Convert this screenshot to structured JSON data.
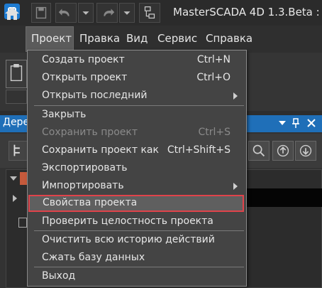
{
  "window": {
    "title": "MasterSCADA 4D 1.3.Beta : По"
  },
  "menubar": {
    "items": [
      "Проект",
      "Правка",
      "Вид",
      "Сервис",
      "Справка"
    ]
  },
  "panel": {
    "title": "Дере"
  },
  "dropdown": {
    "items": [
      {
        "label": "Создать проект",
        "shortcut": "Ctrl+N"
      },
      {
        "label": "Открыть проект",
        "shortcut": "Ctrl+O"
      },
      {
        "label": "Открыть последний",
        "shortcut": ""
      },
      {
        "label": "Закрыть",
        "shortcut": ""
      },
      {
        "label": "Сохранить проект",
        "shortcut": "Ctrl+S"
      },
      {
        "label": "Сохранить проект как",
        "shortcut": "Ctrl+Shift+S"
      },
      {
        "label": "Экспортировать",
        "shortcut": ""
      },
      {
        "label": "Импортировать",
        "shortcut": ""
      },
      {
        "label": "Свойства проекта",
        "shortcut": ""
      },
      {
        "label": "Проверить целостность проекта",
        "shortcut": ""
      },
      {
        "label": "Очистить всю историю действий",
        "shortcut": ""
      },
      {
        "label": "Сжать базу данных",
        "shortcut": ""
      },
      {
        "label": "Выход",
        "shortcut": ""
      }
    ]
  },
  "colors": {
    "highlight_border": "#e0434b",
    "panel_header": "#1f6fb8",
    "app_logo": "#1e7bd1"
  },
  "icons": {
    "app_logo": "app-logo-icon",
    "home": "home-icon",
    "save": "save-icon",
    "undo": "undo-icon",
    "redo": "redo-icon"
  }
}
